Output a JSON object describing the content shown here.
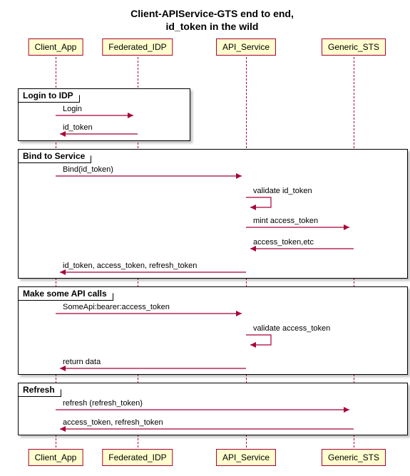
{
  "title_line1": "Client-APIService-GTS end to end,",
  "title_line2": "id_token in the wild",
  "participants": {
    "client": "Client_App",
    "idp": "Federated_IDP",
    "api": "API_Service",
    "sts": "Generic_STS"
  },
  "groups": {
    "login": "Login to IDP",
    "bind": "Bind to Service",
    "calls": "Make some API calls",
    "refresh": "Refresh"
  },
  "messages": {
    "login": "Login",
    "id_token": "id_token",
    "bind_id": "Bind(id_token)",
    "validate_id": "validate id_token",
    "mint": "mint access_token",
    "access_etc": "access_token,etc",
    "tokens_all": "id_token, access_token, refresh_token",
    "someapi": "SomeApi:bearer:access_token",
    "validate_access": "validate access_token",
    "return_data": "return data",
    "refresh_req": "refresh (refresh_token)",
    "refresh_resp": "access_token, refresh_token"
  },
  "chart_data": {
    "type": "sequence-diagram",
    "participants": [
      "Client_App",
      "Federated_IDP",
      "API_Service",
      "Generic_STS"
    ],
    "groups": [
      {
        "label": "Login to IDP",
        "messages": [
          {
            "from": "Client_App",
            "to": "Federated_IDP",
            "text": "Login",
            "return": false
          },
          {
            "from": "Federated_IDP",
            "to": "Client_App",
            "text": "id_token",
            "return": true
          }
        ]
      },
      {
        "label": "Bind to Service",
        "messages": [
          {
            "from": "Client_App",
            "to": "API_Service",
            "text": "Bind(id_token)",
            "return": false
          },
          {
            "from": "API_Service",
            "to": "API_Service",
            "text": "validate id_token",
            "return": false
          },
          {
            "from": "API_Service",
            "to": "Generic_STS",
            "text": "mint access_token",
            "return": false
          },
          {
            "from": "Generic_STS",
            "to": "API_Service",
            "text": "access_token,etc",
            "return": true
          },
          {
            "from": "API_Service",
            "to": "Client_App",
            "text": "id_token, access_token, refresh_token",
            "return": true
          }
        ]
      },
      {
        "label": "Make some API calls",
        "messages": [
          {
            "from": "Client_App",
            "to": "API_Service",
            "text": "SomeApi:bearer:access_token",
            "return": false
          },
          {
            "from": "API_Service",
            "to": "API_Service",
            "text": "validate access_token",
            "return": false
          },
          {
            "from": "API_Service",
            "to": "Client_App",
            "text": "return data",
            "return": true
          }
        ]
      },
      {
        "label": "Refresh",
        "messages": [
          {
            "from": "Client_App",
            "to": "Generic_STS",
            "text": "refresh (refresh_token)",
            "return": false
          },
          {
            "from": "Generic_STS",
            "to": "Client_App",
            "text": "access_token, refresh_token",
            "return": true
          }
        ]
      }
    ]
  }
}
